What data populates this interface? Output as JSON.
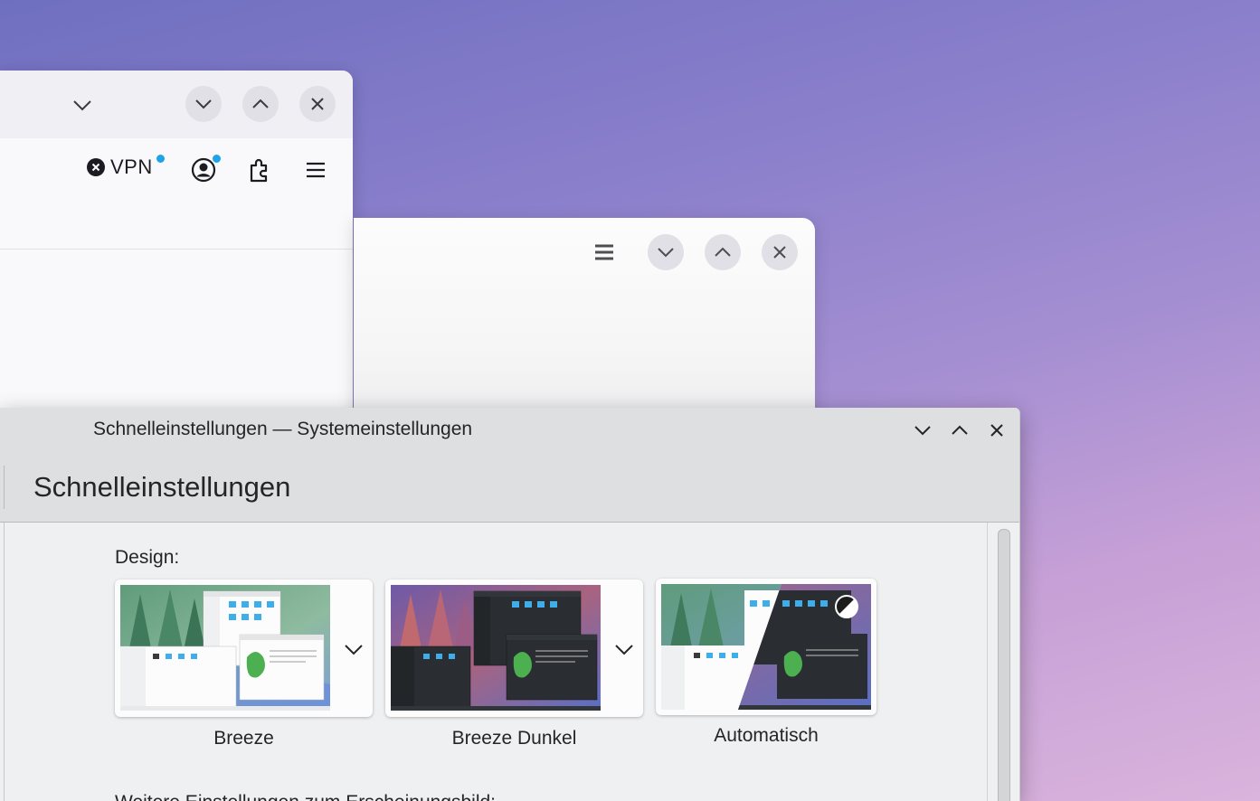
{
  "browser": {
    "vpn_label": "VPN"
  },
  "settings": {
    "window_title": "Schnelleinstellungen — Systemeinstellungen",
    "page_title": "Schnelleinstellungen",
    "design_label": "Design:",
    "themes": [
      {
        "label": "Breeze"
      },
      {
        "label": "Breeze Dunkel"
      },
      {
        "label": "Automatisch"
      }
    ],
    "more_settings_label": "Weitere Einstellungen zum Erscheinungsbild:"
  },
  "colors": {
    "accent": "#1da4e8",
    "text": "#232629",
    "window_bg": "#eff0f1",
    "titlebar_bg": "#dedfe1"
  }
}
